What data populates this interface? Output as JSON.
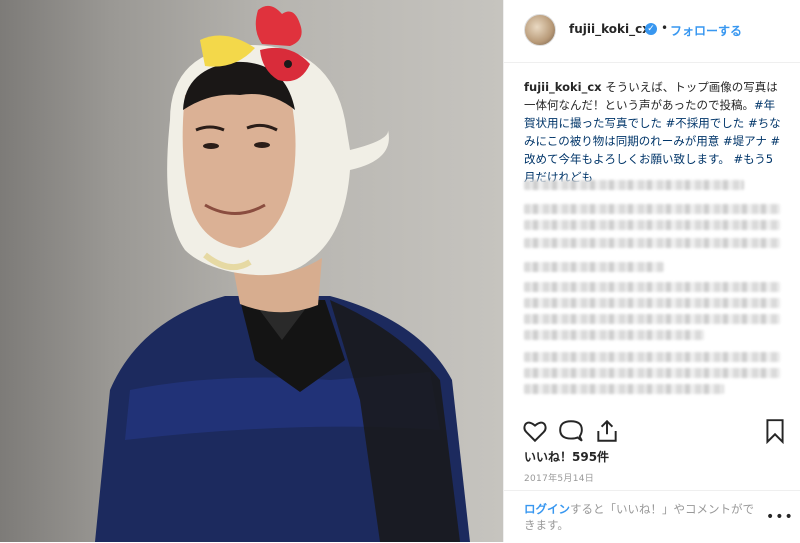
{
  "post": {
    "username": "fujii_koki_cx",
    "verified_icon": "verified-badge-icon",
    "separator": "•",
    "follow_label": "フォローする",
    "caption": {
      "username": "fujii_koki_cx",
      "text_1": " そういえば、トップ画像の写真は一体何なんだ！という声があったので投稿。",
      "tag_1": "#年賀状用に撮った写真でした",
      "text_2": " ",
      "tag_2": "#不採用でした",
      "text_3": " ",
      "tag_3": "#ちなみにこの被り物は同期のれーみが用意",
      "text_4": " ",
      "tag_4": "#堤アナ",
      "text_5": " ",
      "tag_5": "#改めて今年もよろしくお願い致します。",
      "text_6": " ",
      "tag_6": "#もう5月だけれども"
    },
    "likes": "いいね！595件",
    "date": "2017年5月14日",
    "login_link": "ログイン",
    "login_text": "すると「いいね！」やコメントができます。",
    "more_label": "•••",
    "photo_icon": "post-photo"
  },
  "colors": {
    "link": "#3897f0",
    "hashtag": "#003569",
    "text": "#262626",
    "muted": "#999999"
  }
}
